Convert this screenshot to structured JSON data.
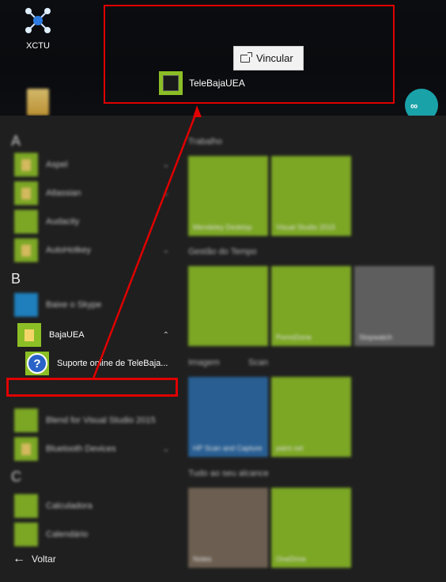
{
  "desktop": {
    "xctu_label": "XCTU",
    "tooltip_label": "Vincular",
    "dragged_label": "TeleBajaUEA"
  },
  "start_menu": {
    "letters": [
      "A",
      "B",
      "C"
    ],
    "apps_a": [
      {
        "label": "Aspel"
      },
      {
        "label": "Atlassian"
      },
      {
        "label": "Audacity"
      },
      {
        "label": "AutoHotkey"
      }
    ],
    "apps_b": [
      {
        "label": "Baixe o Skype"
      },
      {
        "label": "BajaUEA"
      },
      {
        "label": "Suporte online de TeleBaja..."
      },
      {
        "label": "Blend for Visual Studio 2015"
      },
      {
        "label": "Bluetooth Devices"
      }
    ],
    "apps_c": [
      {
        "label": "Calculadora"
      },
      {
        "label": "Calendário"
      }
    ],
    "back_label": "Voltar"
  },
  "tiles": {
    "groups": [
      "Trabalho",
      "Gestão do Tempo",
      "Imagem",
      "Scan",
      "Tudo ao seu alcance"
    ],
    "items": [
      "Mendeley Desktop",
      "Visual Studio 2015",
      "PomoDone",
      "Stopwatch",
      "HP Scan and Capture",
      "paint.net",
      "Notes",
      "OneDrive"
    ]
  },
  "colors": {
    "accent": "#8cbf26",
    "highlight": "#e00000",
    "menu_bg": "#1f1f1f"
  }
}
